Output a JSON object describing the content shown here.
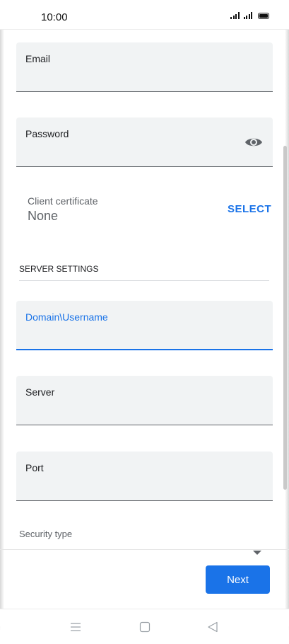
{
  "status_bar": {
    "time": "10:00",
    "icons": [
      "signal-icon",
      "signal-icon",
      "battery-icon"
    ]
  },
  "form": {
    "email": {
      "label": "Email",
      "value": ""
    },
    "password": {
      "label": "Password",
      "value": "",
      "toggle_icon": "eye-icon"
    },
    "client_certificate": {
      "label": "Client certificate",
      "value": "None",
      "action": "SELECT"
    },
    "server_settings": {
      "section_title": "SERVER SETTINGS",
      "domain_username": {
        "label": "Domain\\Username",
        "value": ""
      },
      "server": {
        "label": "Server",
        "value": ""
      },
      "port": {
        "label": "Port",
        "value": ""
      },
      "security_type": {
        "label": "Security type",
        "value": ""
      }
    }
  },
  "actions": {
    "next_label": "Next"
  },
  "nav_bar": {
    "icons": [
      "menu-icon",
      "home-icon",
      "back-icon"
    ]
  },
  "colors": {
    "accent": "#1a73e8",
    "field_bg": "#f1f3f4"
  }
}
